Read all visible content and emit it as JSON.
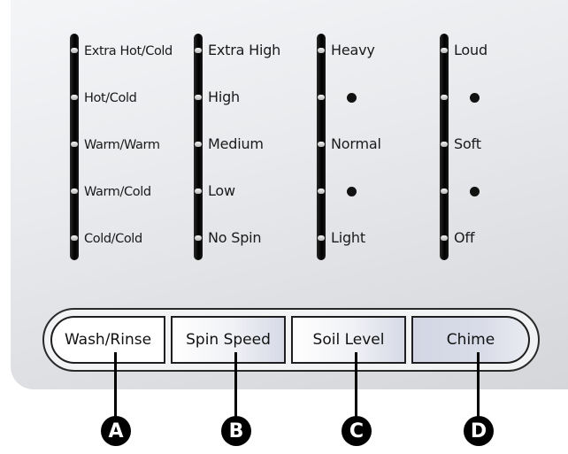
{
  "columns": [
    {
      "labels": [
        "Extra Hot/Cold",
        "Hot/Cold",
        "Warm/Warm",
        "Warm/Cold",
        "Cold/Cold"
      ]
    },
    {
      "labels": [
        "Extra High",
        "High",
        "Medium",
        "Low",
        "No Spin"
      ]
    },
    {
      "labels": [
        "Heavy",
        "",
        "Normal",
        "",
        "Light"
      ]
    },
    {
      "labels": [
        "Loud",
        "",
        "Soft",
        "",
        "Off"
      ]
    }
  ],
  "buttons": {
    "wash_rinse": "Wash/Rinse",
    "spin_speed": "Spin Speed",
    "soil_level": "Soil Level",
    "chime": "Chime"
  },
  "callouts": {
    "a": "A",
    "b": "B",
    "c": "C",
    "d": "D"
  },
  "colors": {
    "panel": "#e4e6e9",
    "indicator_bar": "#000000",
    "callout_badge": "#000000"
  }
}
